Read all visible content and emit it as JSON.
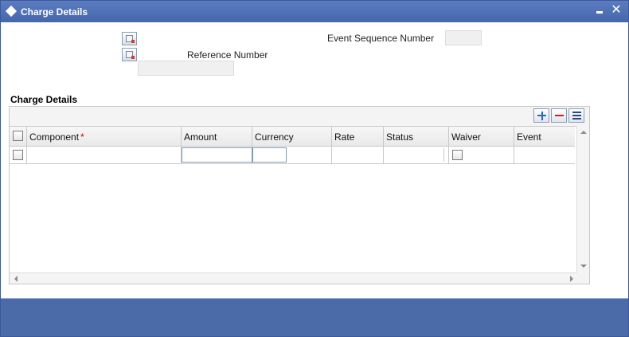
{
  "window": {
    "title": "Charge Details",
    "minimize_glyph": "▁",
    "close_glyph": "✕"
  },
  "header": {
    "event_sequence_label": "Event Sequence Number",
    "event_sequence_value": "",
    "reference_label": "Reference Number",
    "reference_value": ""
  },
  "section": {
    "title": "Charge Details"
  },
  "grid": {
    "columns": [
      {
        "label": "Component",
        "required": true
      },
      {
        "label": "Amount"
      },
      {
        "label": "Currency"
      },
      {
        "label": "Rate"
      },
      {
        "label": "Status"
      },
      {
        "label": "Waiver"
      },
      {
        "label": "Event"
      }
    ],
    "required_marker": "*",
    "rows": [
      {
        "component": "",
        "amount": "",
        "currency": "",
        "rate": "",
        "status": "",
        "waiver": false,
        "event": ""
      }
    ]
  },
  "icons": {
    "title": "diamond-icon",
    "add": "plus-icon",
    "delete": "minus-icon",
    "view": "list-icon"
  },
  "colors": {
    "titlebar": "#4a6aa8",
    "add_icon": "#2a66c8",
    "delete_icon": "#d02020",
    "required": "#d00000"
  }
}
